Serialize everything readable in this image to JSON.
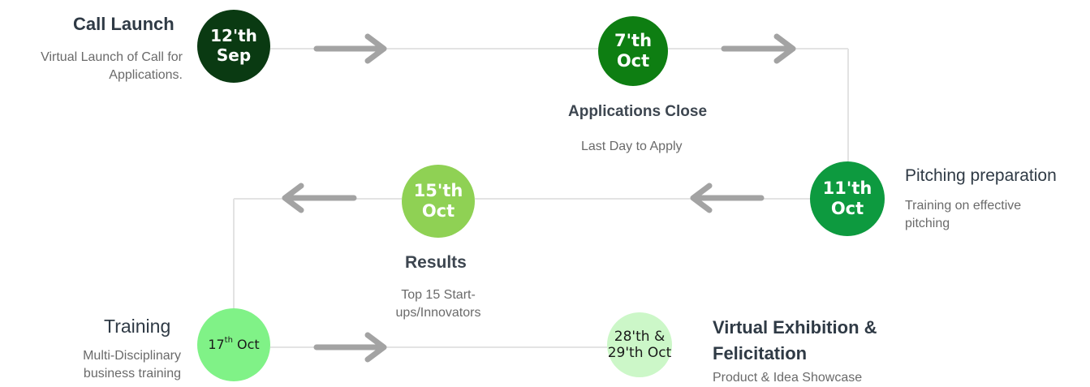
{
  "timeline": {
    "nodes": [
      {
        "date_top": "12'th",
        "date_bottom": "Sep"
      },
      {
        "date_top": "7'th",
        "date_bottom": "Oct"
      },
      {
        "date_top": "11'th",
        "date_bottom": "Oct"
      },
      {
        "date_top": "15'th",
        "date_bottom": "Oct"
      },
      {
        "date_prefix": "17",
        "date_sup": "th",
        "date_suffix": " Oct"
      },
      {
        "date_top": "28'th &",
        "date_bottom": "29'th Oct"
      }
    ],
    "steps": [
      {
        "title": "Call Launch",
        "description_line1": "Virtual Launch of Call for",
        "description_line2": "Applications."
      },
      {
        "title": "Applications Close",
        "description": "Last Day to Apply"
      },
      {
        "title": "Pitching preparation",
        "description_line1": "Training on effective",
        "description_line2": "pitching"
      },
      {
        "title": "Results",
        "description": "Top 15 Start-ups/Innovators"
      },
      {
        "title": "Training",
        "description_line1": "Multi-Disciplinary",
        "description_line2": "business training"
      },
      {
        "title_line1": "Virtual Exhibition &",
        "title_line2": "Felicitation",
        "description": "Product & Idea Showcase"
      }
    ]
  },
  "colors": {
    "connector": "#e3e3e3",
    "arrow": "#a3a3a3",
    "node_1": "#0a3a12",
    "node_2": "#0e7e12",
    "node_3": "#0d9a3f",
    "node_4": "#8fd154",
    "node_5": "#80f287",
    "node_6": "#ccf7c8"
  }
}
